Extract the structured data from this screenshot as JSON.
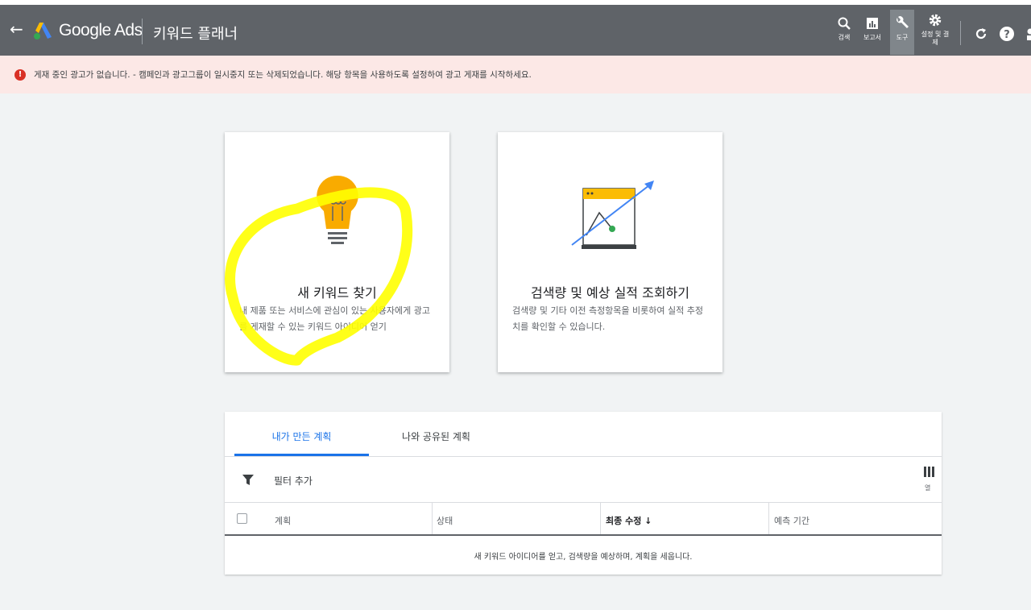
{
  "header": {
    "brand": "Google Ads",
    "page_title": "키워드 플래너",
    "actions": [
      {
        "label": "검색",
        "icon": "search-icon"
      },
      {
        "label": "보고서",
        "icon": "reports-icon"
      },
      {
        "label": "도구",
        "icon": "wrench-icon"
      },
      {
        "label": "설정 및 결제",
        "icon": "gear-icon"
      }
    ]
  },
  "alert": {
    "text": "게재 중인 광고가 없습니다. - 캠페인과 광고그룹이 일시중지 또는 삭제되었습니다. 해당 항목을 사용하도록 설정하여 광고 게재를 시작하세요."
  },
  "cards": [
    {
      "title": "새 키워드 찾기",
      "description": "내 제품 또는 서비스에 관심이 있는 사용자에게 광고를 게재할 수 있는 키워드 아이디어 얻기",
      "icon": "lightbulb-icon"
    },
    {
      "title": "검색량 및 예상 실적 조회하기",
      "description": "검색량 및 기타 이전 측정항목을 비롯하여 실적 추정치를 확인할 수 있습니다.",
      "icon": "forecast-chart-icon"
    }
  ],
  "plans": {
    "tabs": [
      "내가 만든 계획",
      "나와 공유된 계획"
    ],
    "filter_label": "필터 추가",
    "columns_label": "열",
    "columns": [
      "계획",
      "상태",
      "최종 수정 ↓",
      "예측 기간"
    ],
    "empty_message": "새 키워드 아이디어를 얻고, 검색량을 예상하며, 계획을 세웁니다."
  },
  "colors": {
    "topbar": "#5f6368",
    "alert_bg": "#fce8e6",
    "accent": "#1a73e8",
    "highlight": "#ffff00"
  }
}
